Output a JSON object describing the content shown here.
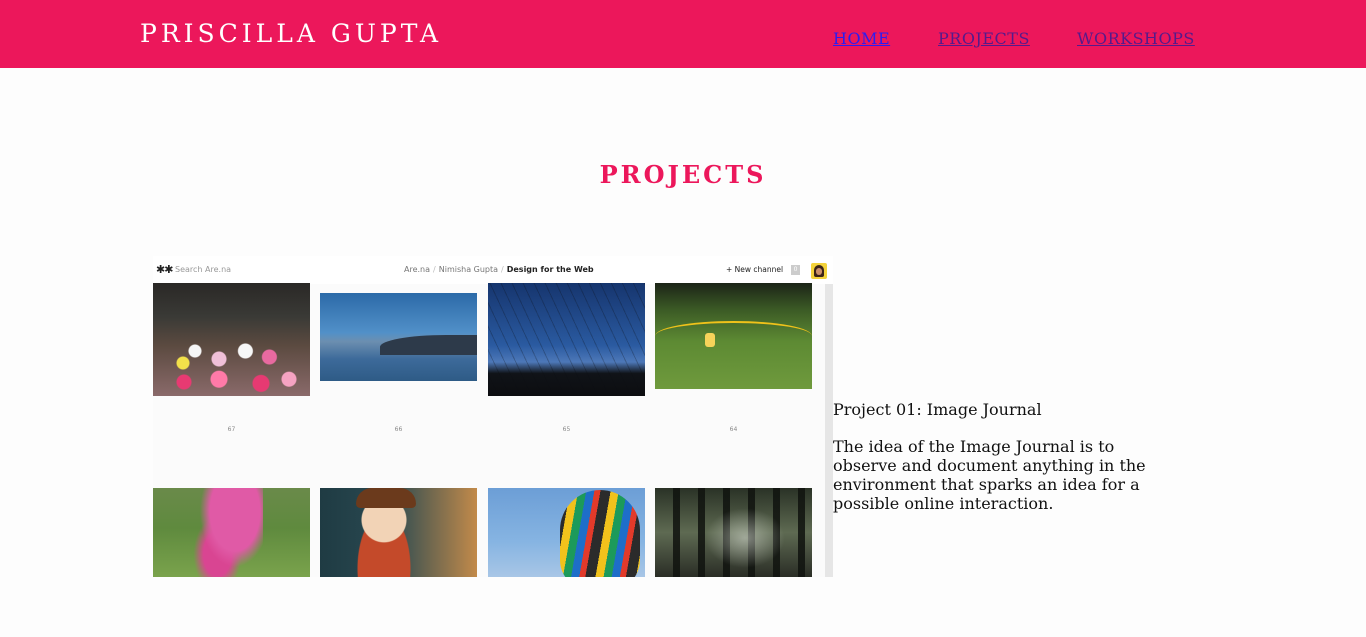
{
  "header": {
    "brand": "PRISCILLA GUPTA",
    "nav": {
      "home": "HOME",
      "projects": "PROJECTS",
      "workshops": "WORKSHOPS"
    }
  },
  "page": {
    "title": "PROJECTS"
  },
  "screenshot": {
    "logo": "✱✱",
    "search_placeholder": "Search Are.na",
    "breadcrumb": {
      "root": "Are.na",
      "sep1": "/",
      "user": "Nimisha Gupta",
      "sep2": "/",
      "channel": "Design for the Web"
    },
    "new_channel": "+  New channel",
    "badge": "0",
    "block_numbers": [
      "67",
      "66",
      "65",
      "64"
    ]
  },
  "project": {
    "title": "Project 01: Image Journal",
    "description": "The idea of the Image Journal is to observe and document anything in the environment that sparks an idea for a possible online interaction."
  },
  "colors": {
    "accent": "#ec175b",
    "link_active": "#2b1df0",
    "link_visited": "#551a8b"
  }
}
